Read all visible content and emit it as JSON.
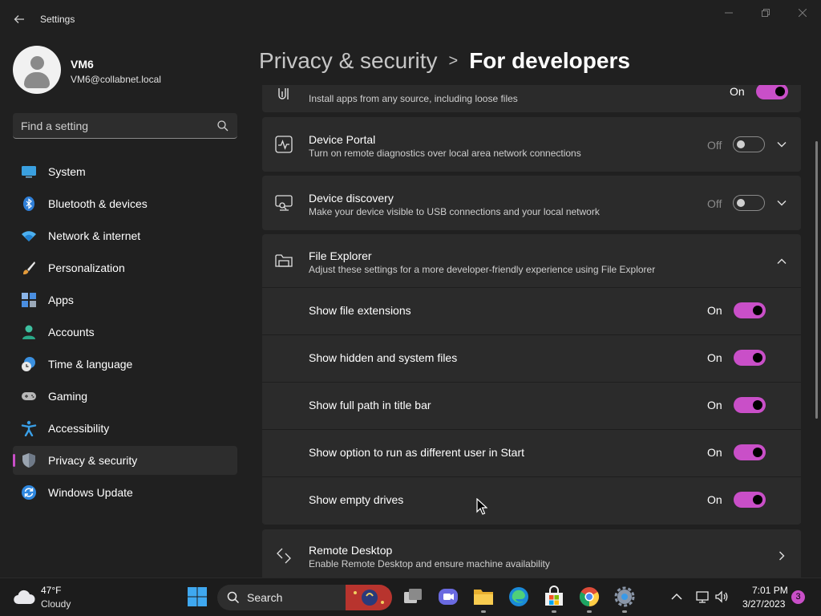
{
  "window": {
    "title": "Settings",
    "back_icon": "back-arrow-icon",
    "controls": [
      "minimize-icon",
      "maximize-icon",
      "close-icon"
    ]
  },
  "profile": {
    "name": "VM6",
    "email": "VM6@collabnet.local"
  },
  "search": {
    "placeholder": "Find a setting",
    "icon": "search-icon"
  },
  "sidebar": {
    "items": [
      {
        "label": "System",
        "icon": "system-icon",
        "active": false
      },
      {
        "label": "Bluetooth & devices",
        "icon": "bluetooth-icon",
        "active": false
      },
      {
        "label": "Network & internet",
        "icon": "wifi-icon",
        "active": false
      },
      {
        "label": "Personalization",
        "icon": "brush-icon",
        "active": false
      },
      {
        "label": "Apps",
        "icon": "apps-icon",
        "active": false
      },
      {
        "label": "Accounts",
        "icon": "account-icon",
        "active": false
      },
      {
        "label": "Time & language",
        "icon": "clock-globe-icon",
        "active": false
      },
      {
        "label": "Gaming",
        "icon": "gamepad-icon",
        "active": false
      },
      {
        "label": "Accessibility",
        "icon": "accessibility-icon",
        "active": false
      },
      {
        "label": "Privacy & security",
        "icon": "shield-icon",
        "active": true
      },
      {
        "label": "Windows Update",
        "icon": "update-icon",
        "active": false
      }
    ]
  },
  "header": {
    "parent": "Privacy & security",
    "separator": ">",
    "current": "For developers"
  },
  "settings": {
    "developer_mode": {
      "description": "Install apps from any source, including loose files",
      "state": "On"
    },
    "device_portal": {
      "title": "Device Portal",
      "description": "Turn on remote diagnostics over local area network connections",
      "state": "Off"
    },
    "device_discovery": {
      "title": "Device discovery",
      "description": "Make your device visible to USB connections and your local network",
      "state": "Off"
    },
    "file_explorer": {
      "title": "File Explorer",
      "description": "Adjust these settings for a more developer-friendly experience using File Explorer",
      "expanded": true,
      "options": [
        {
          "label": "Show file extensions",
          "state": "On"
        },
        {
          "label": "Show hidden and system files",
          "state": "On"
        },
        {
          "label": "Show full path in title bar",
          "state": "On"
        },
        {
          "label": "Show option to run as different user in Start",
          "state": "On"
        },
        {
          "label": "Show empty drives",
          "state": "On"
        }
      ]
    },
    "remote_desktop": {
      "title": "Remote Desktop",
      "description": "Enable Remote Desktop and ensure machine availability"
    }
  },
  "taskbar": {
    "weather": {
      "temp": "47°F",
      "condition": "Cloudy",
      "icon": "cloud-icon"
    },
    "search_label": "Search",
    "apps": [
      "start-icon",
      "search-icon",
      "task-view-icon",
      "teams-chat-icon",
      "file-explorer-icon",
      "edge-icon",
      "store-icon",
      "chrome-icon",
      "settings-icon"
    ],
    "tray": [
      "chevron-up-icon",
      "network-icon",
      "volume-icon"
    ],
    "clock": {
      "time": "7:01 PM",
      "date": "3/27/2023"
    },
    "notifications": "3"
  },
  "colors": {
    "accent": "#c94fc8",
    "background": "#202020",
    "card": "#2b2b2b"
  }
}
